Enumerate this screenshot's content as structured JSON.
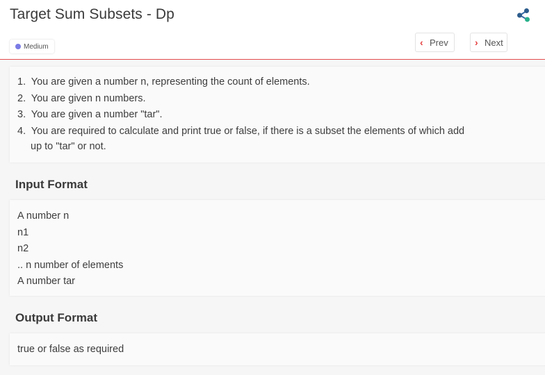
{
  "header": {
    "title": "Target Sum Subsets - Dp",
    "difficulty": "Medium",
    "prev_label": "Prev",
    "next_label": "Next",
    "share_icon": "share-icon",
    "accent_color": "#e4403f"
  },
  "description": {
    "items": [
      {
        "num": "1.",
        "text": "You are given a number n, representing the count of elements.",
        "cont": ""
      },
      {
        "num": "2.",
        "text": "You are given n numbers.",
        "cont": ""
      },
      {
        "num": "3.",
        "text": "You are given a number \"tar\".",
        "cont": ""
      },
      {
        "num": "4.",
        "text": "You are required to calculate and print true or false, if there is a subset the elements of which add",
        "cont": "up to \"tar\" or not."
      }
    ]
  },
  "input_format": {
    "title": "Input Format",
    "lines": [
      "A number n",
      "n1",
      "n2",
      ".. n number of elements",
      "A number tar"
    ]
  },
  "output_format": {
    "title": "Output Format",
    "lines": [
      "true or false as required"
    ]
  }
}
